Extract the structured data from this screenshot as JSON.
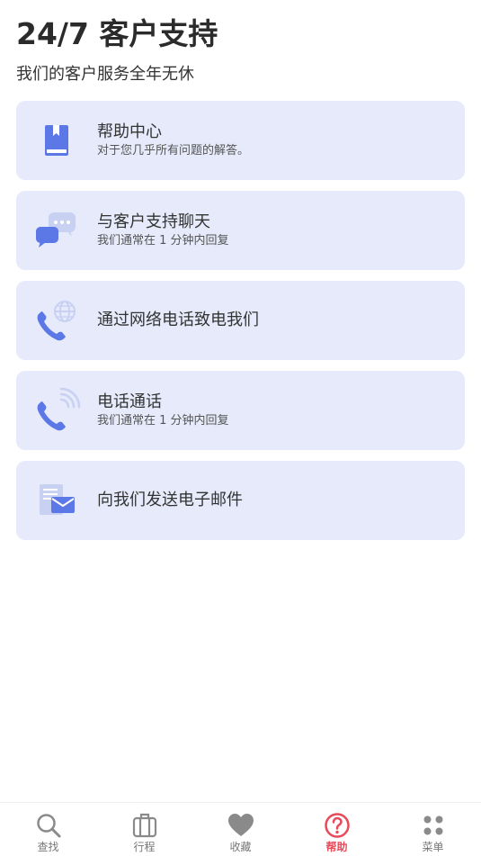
{
  "header": {
    "title": "24/7 客户支持",
    "subtitle": "我们的客户服务全年无休"
  },
  "options": [
    {
      "label": "帮助中心",
      "desc": "对于您几乎所有问题的解答。",
      "icon": "help-book-icon"
    },
    {
      "label": "与客户支持聊天",
      "desc": "我们通常在 1 分钟内回复",
      "icon": "chat-bubbles-icon"
    },
    {
      "label": "通过网络电话致电我们",
      "desc": "",
      "icon": "web-phone-icon"
    },
    {
      "label": "电话通话",
      "desc": "我们通常在 1 分钟内回复",
      "icon": "phone-call-icon"
    },
    {
      "label": "向我们发送电子邮件",
      "desc": "",
      "icon": "email-icon"
    }
  ],
  "tabbar": {
    "items": [
      {
        "label": "查找",
        "icon": "search-icon",
        "active": false
      },
      {
        "label": "行程",
        "icon": "luggage-icon",
        "active": false
      },
      {
        "label": "收藏",
        "icon": "heart-icon",
        "active": false
      },
      {
        "label": "帮助",
        "icon": "question-icon",
        "active": true
      },
      {
        "label": "菜单",
        "icon": "menu-dots-icon",
        "active": false
      }
    ]
  },
  "colors": {
    "accent_icon": "#5b78e6",
    "card_background": "#e6eafa",
    "active_tab": "#e84a5a",
    "inactive_tab": "#8a8a8a"
  }
}
